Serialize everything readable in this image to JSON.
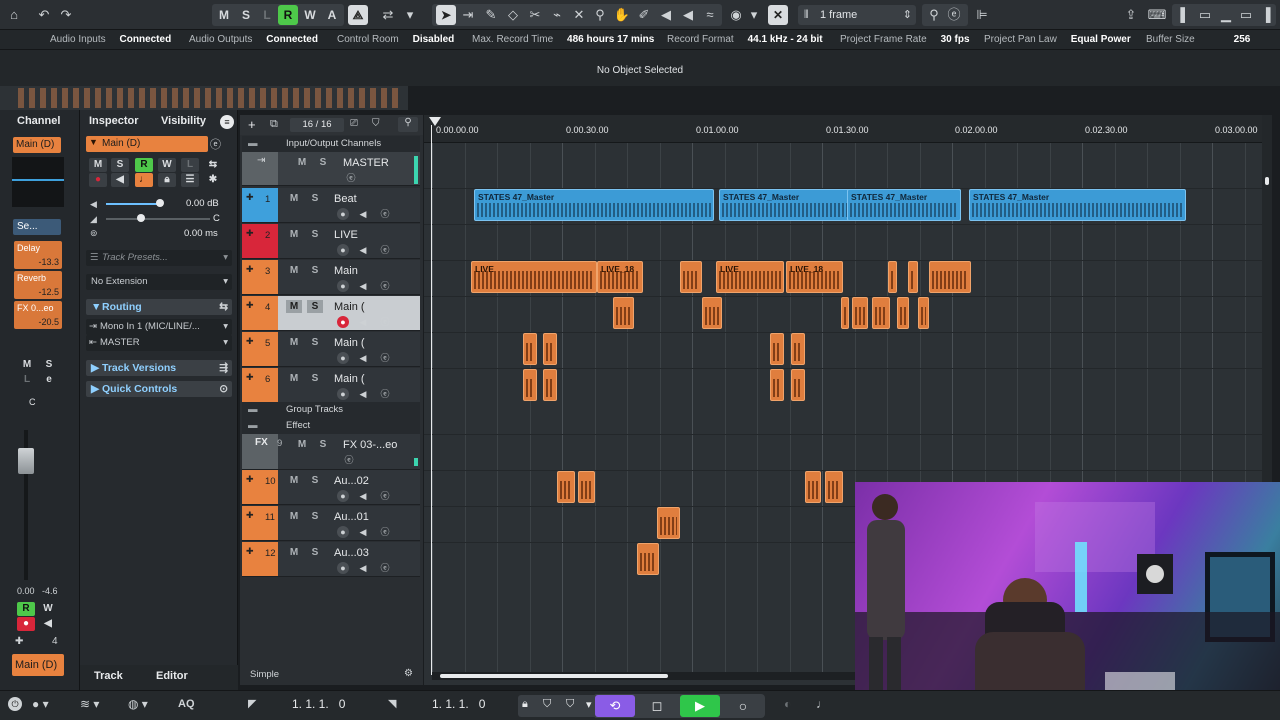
{
  "toolbar": {
    "mute_label": "M",
    "solo_label": "S",
    "listen_label": "L",
    "read_label": "R",
    "write_label": "W",
    "auto_label": "A",
    "quantize_value": "1 frame",
    "icons": [
      "home-icon",
      "undo-icon",
      "redo-icon",
      "autoscroll-icon",
      "pointer-icon",
      "range-icon",
      "pencil-icon",
      "eraser-icon",
      "split-icon",
      "glue-icon",
      "mute-tool-icon",
      "zoom-icon",
      "hand-icon",
      "play-tool-icon",
      "warp-icon",
      "snap-icon",
      "cpu-icon",
      "layout-icon"
    ]
  },
  "status": [
    {
      "label": "Audio Inputs",
      "value": "Connected"
    },
    {
      "label": "Audio Outputs",
      "value": "Connected"
    },
    {
      "label": "Control Room",
      "value": "Disabled"
    },
    {
      "label": "Max. Record Time",
      "value": "486 hours 17 mins"
    },
    {
      "label": "Record Format",
      "value": "44.1 kHz - 24 bit"
    },
    {
      "label": "Project Frame Rate",
      "value": "30 fps"
    },
    {
      "label": "Project Pan Law",
      "value": "Equal Power"
    },
    {
      "label": "Buffer Size",
      "value": "256"
    }
  ],
  "info_line": "No Object Selected",
  "channel_strip": {
    "tab": "Channel",
    "name": "Main (D)",
    "settings_short": "Se...",
    "inserts": [
      {
        "name": "Delay",
        "value": "-13.3"
      },
      {
        "name": "Reverb",
        "value": "-12.5"
      },
      {
        "name": "FX 0...eo",
        "value": "-20.5"
      }
    ],
    "m": "M",
    "s": "S",
    "l": "L",
    "e": "e",
    "c": "C",
    "vol": "0.00",
    "pan": "-4.6",
    "r": "R",
    "w": "W",
    "out_num": "4",
    "bottom_name": "Main (D)"
  },
  "inspector": {
    "tab_inspector": "Inspector",
    "tab_visibility": "Visibility",
    "track_name": "Main (D)",
    "volume": "0.00 dB",
    "pan": "C",
    "delay": "0.00 ms",
    "presets_placeholder": "Track Presets...",
    "extension": "No Extension",
    "routing": "Routing",
    "input": "Mono In 1 (MIC/LINE/...",
    "output": "MASTER",
    "track_versions": "Track Versions",
    "quick_controls": "Quick Controls",
    "bottom_tab_track": "Track",
    "bottom_tab_editor": "Editor"
  },
  "tracklist": {
    "count": "16 / 16",
    "folder_io": "Input/Output Channels",
    "master": "MASTER",
    "group_tracks": "Group Tracks",
    "effect": "Effect",
    "fx_name": "FX 03-...eo",
    "fx_num": "9",
    "fx_tag": "FX",
    "simple": "Simple",
    "tracks": [
      {
        "num": "1",
        "name": "Beat",
        "color": "#3ea0dc"
      },
      {
        "num": "2",
        "name": "LIVE",
        "color": "#d8263a"
      },
      {
        "num": "3",
        "name": "Main",
        "color": "#e8823f"
      },
      {
        "num": "4",
        "name": "Main (",
        "color": "#e8823f"
      },
      {
        "num": "5",
        "name": "Main (",
        "color": "#e8823f"
      },
      {
        "num": "6",
        "name": "Main (",
        "color": "#e8823f"
      }
    ],
    "tracks2": [
      {
        "num": "10",
        "name": "Au...02",
        "color": "#e8823f"
      },
      {
        "num": "11",
        "name": "Au...01",
        "color": "#e8823f"
      },
      {
        "num": "12",
        "name": "Au...03",
        "color": "#e8823f"
      }
    ]
  },
  "ruler": [
    "0.00.00.00",
    "0.00.30.00",
    "0.01.00.00",
    "0.01.30.00",
    "0.02.00.00",
    "0.02.30.00",
    "0.03.00.00"
  ],
  "clips": {
    "beat_label": "STATES 47_Master",
    "main_label_live": "LIVE",
    "main_label_live18": "LIVE_18"
  },
  "transport": {
    "left_locator": "1. 1. 1.   0",
    "right_locator": "1. 1. 1.   0",
    "aq": "AQ"
  },
  "colors": {
    "accent_orange": "#e8823f",
    "accent_blue": "#3ea0dc",
    "record_red": "#d8263a",
    "read_green": "#4ec84a",
    "transport_purple": "#8a5ce6"
  }
}
